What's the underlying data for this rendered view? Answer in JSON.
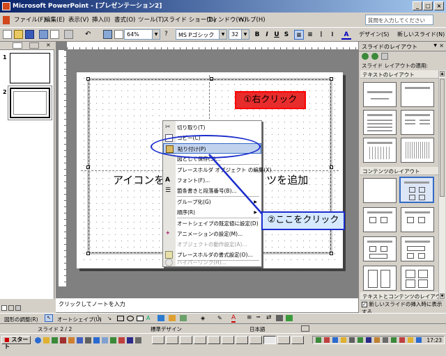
{
  "window": {
    "title": "Microsoft PowerPoint - [プレゼンテーション2]"
  },
  "menu": {
    "items": [
      "ファイル(F)",
      "編集(E)",
      "表示(V)",
      "挿入(I)",
      "書式(O)",
      "ツール(T)",
      "スライド ショー(D)",
      "ウィンドウ(W)",
      "ヘルプ(H)"
    ],
    "help_placeholder": "質問を入力してください"
  },
  "toolbar": {
    "zoom": "64%",
    "font": "MS Pゴシック",
    "font_size": "32",
    "bold": "B",
    "italic": "I",
    "underline": "U",
    "shadow": "S",
    "design_label": "デザイン(S)",
    "new_slide_label": "新しいスライド(N)"
  },
  "left_pane": {
    "slides": [
      "1",
      "2"
    ]
  },
  "slide": {
    "placeholder_text": "アイコンを",
    "placeholder_text_right": "ツを追加"
  },
  "annotations": {
    "right_click": "①右クリック",
    "click_here": "②ここをクリック"
  },
  "context_menu": {
    "items": [
      {
        "label": "切り取り(T)",
        "icon": "scissors-icon",
        "disabled": false,
        "submenu": false
      },
      {
        "label": "コピー(C)",
        "icon": "copy-icon",
        "disabled": false,
        "submenu": false
      },
      {
        "label": "貼り付け(P)",
        "icon": "paste-icon",
        "disabled": false,
        "submenu": false
      },
      {
        "label": "図として保存(S)...",
        "icon": "",
        "disabled": false,
        "submenu": false
      },
      {
        "label": "プレースホルダ オブジェクト の編集(X)",
        "icon": "",
        "disabled": false,
        "submenu": false
      },
      {
        "label": "フォント(F)...",
        "icon": "font-icon",
        "disabled": false,
        "submenu": false
      },
      {
        "label": "箇条書きと段落番号(B)...",
        "icon": "bullets-icon",
        "disabled": false,
        "submenu": false
      },
      {
        "label": "グループ化(G)",
        "icon": "",
        "disabled": false,
        "submenu": true
      },
      {
        "label": "順序(R)",
        "icon": "",
        "disabled": false,
        "submenu": true
      },
      {
        "label": "オートシェイプの既定値に設定(D)",
        "icon": "",
        "disabled": false,
        "submenu": false
      },
      {
        "label": "アニメーションの設定(M)...",
        "icon": "animation-icon",
        "disabled": false,
        "submenu": false
      },
      {
        "label": "オブジェクトの動作設定(A)...",
        "icon": "",
        "disabled": true,
        "submenu": false
      },
      {
        "label": "プレースホルダの書式設定(O)...",
        "icon": "format-icon",
        "disabled": false,
        "submenu": false
      },
      {
        "label": "ハイパーリンク(H)...",
        "icon": "hyperlink-icon",
        "disabled": true,
        "submenu": false
      }
    ]
  },
  "task_pane": {
    "title": "スライドのレイアウト",
    "apply_label": "スライド レイアウトの適用:",
    "section_text": "テキストのレイアウト",
    "section_content": "コンテンツのレイアウト",
    "section_text_content": "テキストとコンテンツのレイアウト",
    "show_on_insert": "新しいスライドの挿入時に表示する"
  },
  "notes": {
    "placeholder": "クリックしてノートを入力"
  },
  "drawing_toolbar": {
    "draw_label": "図形の調整(R)",
    "autoshape_label": "オートシェイプ(U)"
  },
  "status": {
    "slide": "スライド 2 / 2",
    "design": "標準デザイン",
    "language": "日本語"
  },
  "taskbar": {
    "start": "スタート",
    "clock": "17:23"
  }
}
